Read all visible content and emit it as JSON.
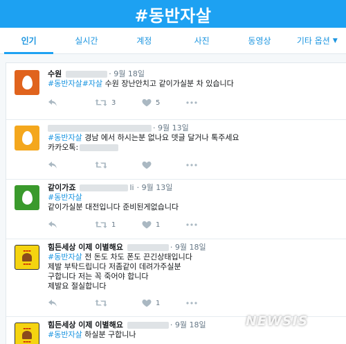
{
  "header": {
    "title": "#동반자살",
    "color": "#1da1f2"
  },
  "tabs": [
    {
      "label": "인기",
      "active": true
    },
    {
      "label": "실시간"
    },
    {
      "label": "계정"
    },
    {
      "label": "사진"
    },
    {
      "label": "동영상"
    },
    {
      "label": "기타 옵션"
    }
  ],
  "tweets": [
    {
      "name": "수원",
      "time": "· 9월 18일",
      "avatar_color": "#e0631d",
      "tag1": "#동반자살",
      "tag2": "#자살",
      "text": " 수원 장난안치고 같이가실분 차 있습니다",
      "retweets": "3",
      "likes": "5"
    },
    {
      "name": "",
      "time": "· 9월 13일",
      "avatar_color": "#f4a71d",
      "tag1": "#동반자살",
      "text": " 경남 에서 하시는분 없나요 뎃글 달거나 톡주세요",
      "text2": "카카오톡:",
      "retweets": "",
      "likes": ""
    },
    {
      "name": "같이가죠",
      "name_suffix": "li",
      "time": "· 9월 13일",
      "avatar_color": "#3a9a2c",
      "tag1": "#동반자살",
      "text": "같이가실분 대전입니다 준비된게없습니다",
      "retweets": "1",
      "likes": "1"
    },
    {
      "name": "힘든세상 이제 이별해요",
      "time": "· 9월 18일",
      "avatar_icon": "protest-sign-avatar",
      "tag1": "#동반자살",
      "text": " 전 돈도 차도 폰도 끈긴상태입니다\n제발 부탁드립니다 저좀같이 데려가주실분\n구합니다  저는 꼭 죽어야 합니다\n제발요 절실합니다",
      "retweets": "",
      "likes": "1"
    },
    {
      "name": "힘든세상 이제 이별해요",
      "time": "· 9월 18일",
      "avatar_icon": "protest-sign-avatar",
      "tag1": "#동반자살",
      "text": " 하실분 구합니나"
    }
  ],
  "watermark": "NEWSIS"
}
